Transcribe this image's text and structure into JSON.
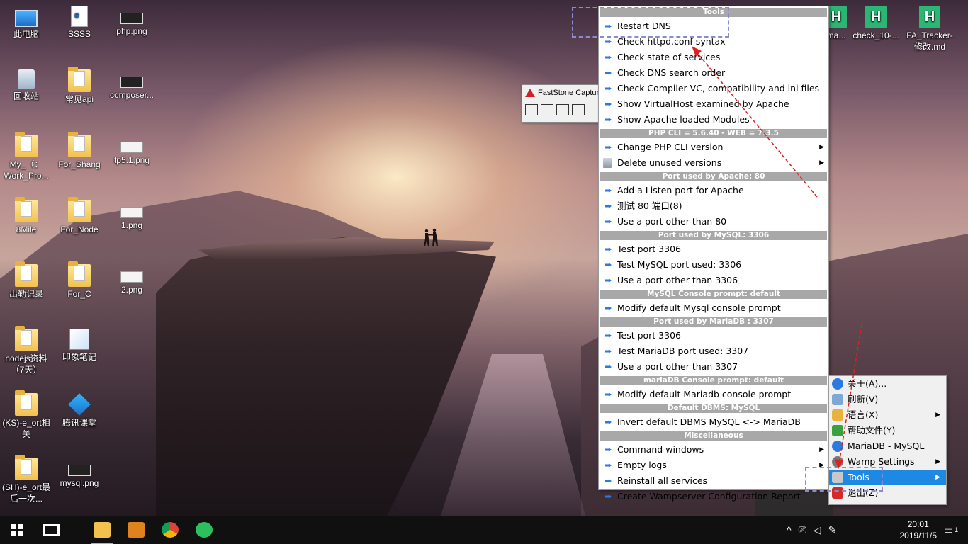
{
  "desktop": {
    "icons": [
      {
        "label": "此电脑"
      },
      {
        "label": "SSSS"
      },
      {
        "label": "php.png"
      },
      {
        "label": "回收站"
      },
      {
        "label": "常见api"
      },
      {
        "label": "composer..."
      },
      {
        "label": "My_（：Work_Pro..."
      },
      {
        "label": "For_Shang"
      },
      {
        "label": "tp5.1.png"
      },
      {
        "label": "8Mile"
      },
      {
        "label": "For_Node"
      },
      {
        "label": "1.png"
      },
      {
        "label": "出勤记录"
      },
      {
        "label": "For_C"
      },
      {
        "label": "2.png"
      },
      {
        "label": "nodejs资料（7天）"
      },
      {
        "label": "印象笔记"
      },
      {
        "label": "(KS)-e_ort相关"
      },
      {
        "label": "腾讯课堂"
      },
      {
        "label": "(SH)-e_ort最后一次..."
      },
      {
        "label": "mysql.png"
      },
      {
        "label": "ma..."
      },
      {
        "label": "check_10-..."
      },
      {
        "label": "FA_Tracker-修改.md"
      }
    ],
    "hbuilder_letter": "H"
  },
  "faststone": {
    "title": "FastStone Captur"
  },
  "tools_menu": {
    "title": "Tools",
    "sections": [
      {
        "items": [
          {
            "label": "Restart DNS"
          },
          {
            "label": "Check httpd.conf syntax"
          },
          {
            "label": "Check state of services"
          },
          {
            "label": "Check DNS search order"
          },
          {
            "label": "Check Compiler VC, compatibility and ini files"
          },
          {
            "label": "Show VirtualHost examined by Apache"
          },
          {
            "label": "Show Apache loaded Modules"
          }
        ]
      },
      {
        "header": "PHP CLI = 5.6.40 - WEB = 7.3.5",
        "items": [
          {
            "label": "Change PHP CLI version"
          },
          {
            "label": "Delete unused versions"
          }
        ]
      },
      {
        "header": "Port used by Apache: 80",
        "items": [
          {
            "label": "Add a Listen port for Apache"
          },
          {
            "label": "测试 80 端口(8)"
          },
          {
            "label": "Use a port other than 80"
          }
        ]
      },
      {
        "header": "Port used by MySQL: 3306",
        "items": [
          {
            "label": "Test port 3306"
          },
          {
            "label": "Test MySQL port used: 3306"
          },
          {
            "label": "Use a port other than 3306"
          }
        ]
      },
      {
        "header": "MySQL Console prompt: default",
        "items": [
          {
            "label": "Modify default Mysql console prompt"
          }
        ]
      },
      {
        "header": "Port used by MariaDB : 3307",
        "items": [
          {
            "label": "Test port 3306"
          },
          {
            "label": "Test MariaDB port used: 3307"
          },
          {
            "label": "Use a port other than 3307"
          }
        ]
      },
      {
        "header": "mariaDB Console prompt: default",
        "items": [
          {
            "label": "Modify default Mariadb console prompt"
          }
        ]
      },
      {
        "header": "Default DBMS: MySQL",
        "items": [
          {
            "label": "Invert default DBMS MySQL <-> MariaDB"
          }
        ]
      },
      {
        "header": "Miscellaneous",
        "items": [
          {
            "label": "Command windows"
          },
          {
            "label": "Empty logs"
          },
          {
            "label": "Reinstall all services"
          },
          {
            "label": "Create Wampserver Configuration Report"
          }
        ]
      }
    ]
  },
  "tray_menu": {
    "items": [
      {
        "label": "关于(A)..."
      },
      {
        "label": "刷新(V)"
      },
      {
        "label": "语言(X)"
      },
      {
        "label": "帮助文件(Y)"
      },
      {
        "label": "MariaDB - MySQL"
      },
      {
        "label": "Wamp Settings"
      },
      {
        "label": "Tools"
      },
      {
        "label": "退出(Z)"
      }
    ]
  },
  "taskbar": {
    "time": "20:01",
    "date": "2019/11/5",
    "notification_count": "1",
    "accent": "#7fb8ff"
  },
  "colors": {
    "menu_header_bg": "#a8a8a8",
    "menu_item_icon": "#2a7ae2",
    "tray_active_bg": "#1e88e5",
    "annotation_arrow": "#e02020",
    "annotation_box": "#8a8ad0"
  }
}
